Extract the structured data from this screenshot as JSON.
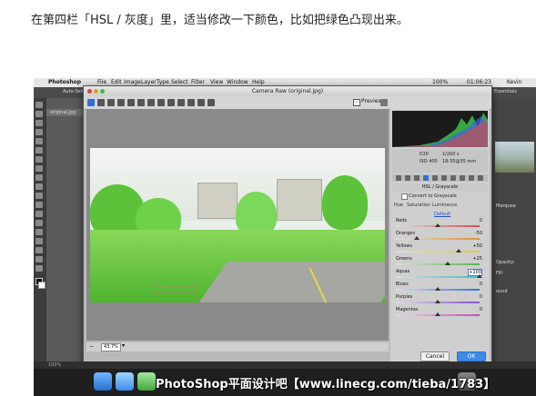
{
  "caption": "在第四栏「HSL / 灰度」里，适当修改一下颜色，比如把绿色凸现出来。",
  "menubar": {
    "apple": "",
    "items": [
      "Photoshop",
      "File",
      "Edit",
      "Image",
      "Layer",
      "Type",
      "Select",
      "Filter",
      "View",
      "Window",
      "Help"
    ],
    "battery": "100%",
    "clock": "01:06:23",
    "user": "Kevin"
  },
  "photoshop": {
    "doc_tab": "original.jpg",
    "option_text": "Auto-Sele",
    "status_zoom": "100%",
    "right_label": "Essentials",
    "panel_label_1": "Marquee",
    "panel_label_2": "Opacity:",
    "panel_label_3": "Fill:",
    "panel_label_4": "ound"
  },
  "dialog": {
    "title": "Camera Raw (original.jpg)",
    "preview_label": "Preview",
    "preview_checked": "✓",
    "zoom_value": "43.7%",
    "cam_info": {
      "aperture": "f/20",
      "shutter": "1/200 s",
      "iso": "ISO 400",
      "lens": "18-35@35 mm"
    },
    "panel_title": "HSL / Grayscale",
    "convert_label": "Convert to Grayscale",
    "subtabs": [
      "Hue",
      "Saturation",
      "Luminance"
    ],
    "default_link": "Default",
    "sliders": [
      {
        "label": "Reds",
        "value": "0",
        "pos": 0.5,
        "color": "#d94b4b"
      },
      {
        "label": "Oranges",
        "value": "-50",
        "pos": 0.25,
        "color": "#e2902f"
      },
      {
        "label": "Yellows",
        "value": "+50",
        "pos": 0.75,
        "color": "#d8cf35"
      },
      {
        "label": "Greens",
        "value": "+25",
        "pos": 0.62,
        "color": "#55b848"
      },
      {
        "label": "Aquas",
        "value": "+100",
        "pos": 1.0,
        "color": "#3fbcc0",
        "active": true
      },
      {
        "label": "Blues",
        "value": "0",
        "pos": 0.5,
        "color": "#3b6fd8"
      },
      {
        "label": "Purples",
        "value": "0",
        "pos": 0.5,
        "color": "#8a4fd0"
      },
      {
        "label": "Magentas",
        "value": "0",
        "pos": 0.5,
        "color": "#cf46b6"
      }
    ],
    "cancel_label": "Cancel",
    "ok_label": "OK"
  },
  "watermark": "PhotoShop平面设计吧【www.linecg.com/tieba/1783】",
  "colors": {
    "dialog_bg": "#b9b9b9",
    "ok_blue": "#3d8be8",
    "dark_ui": "#3a3a3a"
  }
}
